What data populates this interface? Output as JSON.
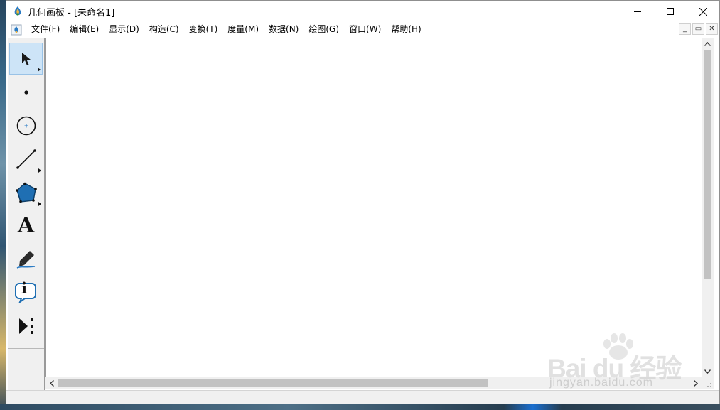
{
  "window": {
    "title": "几何画板 - [未命名1]"
  },
  "menubar": {
    "items": [
      {
        "label": "文件(F)"
      },
      {
        "label": "编辑(E)"
      },
      {
        "label": "显示(D)"
      },
      {
        "label": "构造(C)"
      },
      {
        "label": "变换(T)"
      },
      {
        "label": "度量(M)"
      },
      {
        "label": "数据(N)"
      },
      {
        "label": "绘图(G)"
      },
      {
        "label": "窗口(W)"
      },
      {
        "label": "帮助(H)"
      }
    ],
    "mdi_controls": {
      "minimize": "_",
      "restore": "▭",
      "close": "✕"
    }
  },
  "toolbox": {
    "tools": [
      {
        "name": "arrow-tool",
        "icon": "arrow-pointer-icon",
        "selected": true
      },
      {
        "name": "point-tool",
        "icon": "point-icon",
        "selected": false
      },
      {
        "name": "compass-tool",
        "icon": "circle-icon",
        "selected": false
      },
      {
        "name": "straightedge-tool",
        "icon": "line-segment-icon",
        "selected": false
      },
      {
        "name": "polygon-tool",
        "icon": "pentagon-icon",
        "selected": false
      },
      {
        "name": "text-tool",
        "icon": "letter-a-icon",
        "selected": false
      },
      {
        "name": "marker-tool",
        "icon": "marker-pen-icon",
        "selected": false
      },
      {
        "name": "information-tool",
        "icon": "info-bubble-icon",
        "selected": false
      },
      {
        "name": "custom-tool",
        "icon": "play-custom-icon",
        "selected": false
      }
    ],
    "text_tool_glyph": "A",
    "info_tool_glyph": "i"
  },
  "watermark": {
    "logo_text": "Bai du 经验",
    "sub_text": "jingyan.baidu.com"
  },
  "colors": {
    "selected_tool_bg": "#cde4f7",
    "pentagon_fill": "#1f6fb3",
    "scroll_thumb": "#c2c2c2"
  }
}
